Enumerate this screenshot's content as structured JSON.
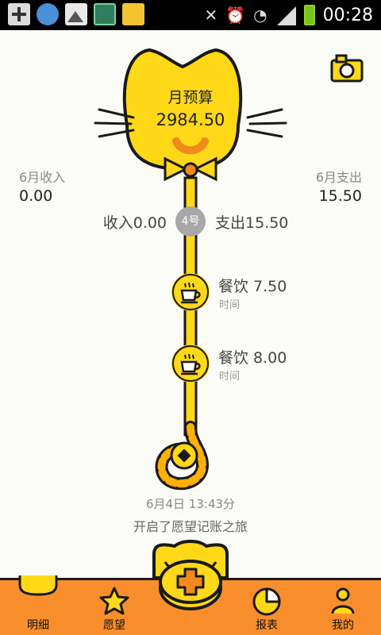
{
  "status_bar": {
    "time": "00:28",
    "left_icons": [
      "add-icon",
      "shield-app-icon",
      "gallery-icon",
      "browser-icon",
      "shopping-app-icon"
    ],
    "right_icons": [
      "mute-icon",
      "alarm-icon",
      "wifi-icon",
      "signal-icon",
      "battery-icon"
    ]
  },
  "summary": {
    "budget_label": "月预算",
    "budget_value": "2984.50",
    "income_label": "6月收入",
    "income_value": "0.00",
    "expense_label": "6月支出",
    "expense_value": "15.50"
  },
  "day": {
    "income": "收入0.00",
    "badge": "4号",
    "expense": "支出15.50"
  },
  "entries": [
    {
      "category": "餐饮",
      "amount": "7.50",
      "title": "餐饮 7.50",
      "sub": "时间",
      "icon": "cup-icon"
    },
    {
      "category": "餐饮",
      "amount": "8.00",
      "title": "餐饮 8.00",
      "sub": "时间",
      "icon": "cup-icon"
    }
  ],
  "start": {
    "date": "6月4日 13:43分",
    "text": "开启了愿望记账之旅"
  },
  "nav": {
    "items": [
      {
        "label": "明细",
        "icon": "cat-head-icon"
      },
      {
        "label": "愿望",
        "icon": "star-icon"
      },
      {
        "label": "",
        "icon": "add-coin-icon"
      },
      {
        "label": "报表",
        "icon": "pie-chart-icon"
      },
      {
        "label": "我的",
        "icon": "person-icon"
      }
    ]
  },
  "colors": {
    "accent_yellow": "#ffd817",
    "nav_orange": "#f98e2c",
    "badge_gray": "#a8a8a8"
  }
}
